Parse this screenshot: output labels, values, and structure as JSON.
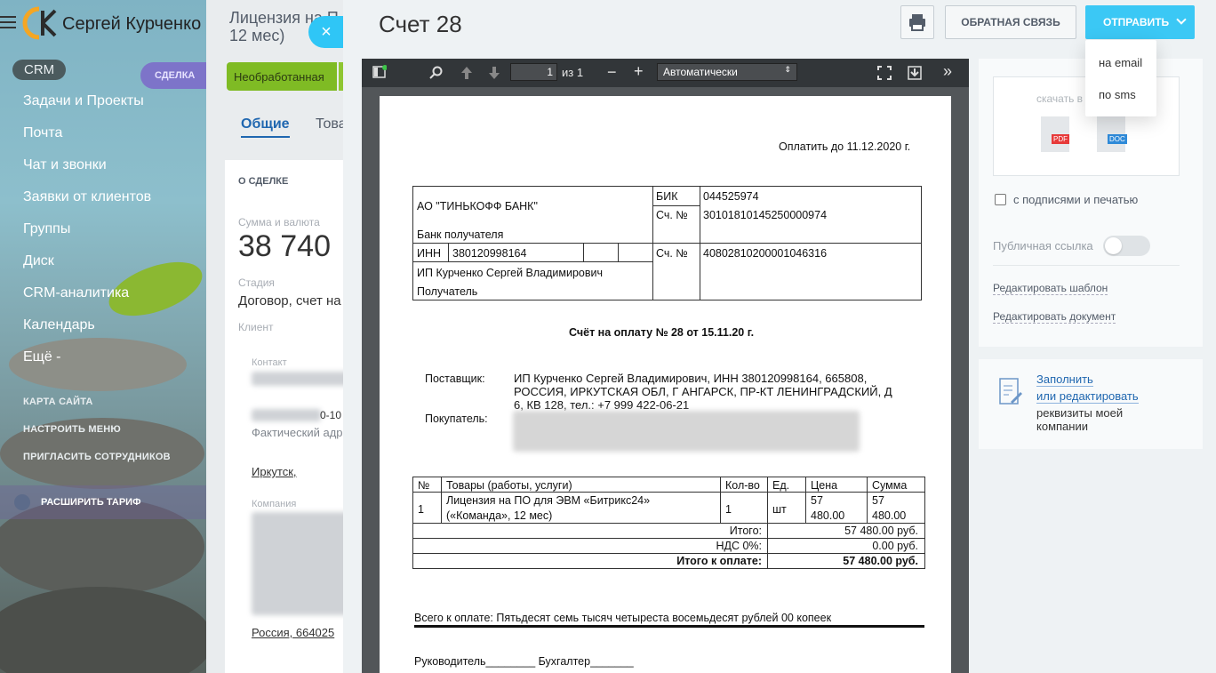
{
  "sidebar": {
    "logo_text": "Сергей Курченко",
    "crm_pill": "CRM",
    "items": [
      "Задачи и Проекты",
      "Почта",
      "Чат и звонки",
      "Заявки от клиентов",
      "Группы",
      "Диск",
      "CRM-аналитика",
      "Календарь",
      "Ещё -"
    ],
    "small_links": [
      "КАРТА САЙТА",
      "НАСТРОИТЬ МЕНЮ",
      "ПРИГЛАСИТЬ СОТРУДНИКОВ"
    ],
    "tariff": "РАСШИРИТЬ ТАРИФ"
  },
  "deal": {
    "title_line1": "Лицензия на П",
    "title_line2": "12  мес)",
    "badge": "СДЕЛКА",
    "stage": "Необработанная",
    "tab_general": "Общие",
    "tab_goods": "Това",
    "section": "О СДЕЛКЕ",
    "amount_label": "Сумма и валюта",
    "amount": "38 740",
    "stage_label": "Стадия",
    "stage_value": "Договор, счет на",
    "client_label": "Клиент",
    "contact_label": "Контакт",
    "phone_tail": "0-10",
    "address_label": "Фактический адр",
    "city": "Иркутск,",
    "company_label": "Компания",
    "country_zip": "Россия, 664025"
  },
  "slider": {
    "title": "Счет 28",
    "close_icon": "×",
    "feedback": "ОБРАТНАЯ СВЯЗЬ",
    "send": "ОТПРАВИТЬ",
    "send_options": [
      "на email",
      "по sms"
    ]
  },
  "viewer": {
    "page_value": "1",
    "page_total": "из 1",
    "zoom": "Автоматически"
  },
  "invoice": {
    "pay_until": "Оплатить до 11.12.2020 г.",
    "bank_name": "АО \"ТИНЬКОФФ БАНК\"",
    "bank_recipient": "Банк получателя",
    "bik_label": "БИК",
    "bik": "044525974",
    "corr_label": "Сч. №",
    "corr": "30101810145250000974",
    "inn_label": "ИНН",
    "inn": "380120998164",
    "acc_label": "Сч. №",
    "acc": "40802810200001046316",
    "recipient_name": "ИП Курченко Сергей Владимирович",
    "recipient_label": "Получатель",
    "title": "Счёт на оплату № 28 от 15.11.20 г.",
    "supplier_label": "Поставщик:",
    "supplier_lines": [
      "ИП Курченко Сергей Владимирович, ИНН 380120998164, 665808,",
      "РОССИЯ, ИРКУТСКАЯ ОБЛ, Г АНГАРСК, ПР-КТ ЛЕНИНГРАДСКИЙ, Д",
      "6, КВ 128, тел.: +7 999 422-06-21"
    ],
    "buyer_label": "Покупатель:",
    "table_headers": [
      "№",
      "Товары (работы, услуги)",
      "Кол-во",
      "Ед.",
      "Цена",
      "Сумма"
    ],
    "row": {
      "n": "1",
      "name1": "Лицензия на ПО для ЭВМ «Битрикс24»",
      "name2": "(«Команда», 12 мес)",
      "qty": "1",
      "unit": "шт",
      "price1": "57",
      "price2": "480.00",
      "sum1": "57",
      "sum2": "480.00"
    },
    "total_label": "Итого:",
    "total": "57 480.00 руб.",
    "vat_label": "НДС 0%:",
    "vat": "0.00 руб.",
    "due_label": "Итого к оплате:",
    "due": "57 480.00 руб.",
    "words": "Всего к оплате: Пятьдесят семь тысяч четыреста восемьдесят рублей 00 копеек",
    "signatures": "Руководитель________ Бухгалтер_______"
  },
  "right": {
    "download": "скачать в",
    "pdf": "PDF",
    "doc": "DOC",
    "with_signs": "с подписями и печатью",
    "public_link": "Публичная ссылка",
    "edit_template": "Редактировать шаблон",
    "edit_doc": "Редактировать документ",
    "fill1": "Заполнить",
    "fill2": "или редактировать",
    "fill3": "реквизиты моей",
    "fill4": "компании"
  },
  "colors": {
    "accent": "#3bc8f5",
    "stage": "#7fbb24",
    "deal_badge": "#7d74c9"
  }
}
